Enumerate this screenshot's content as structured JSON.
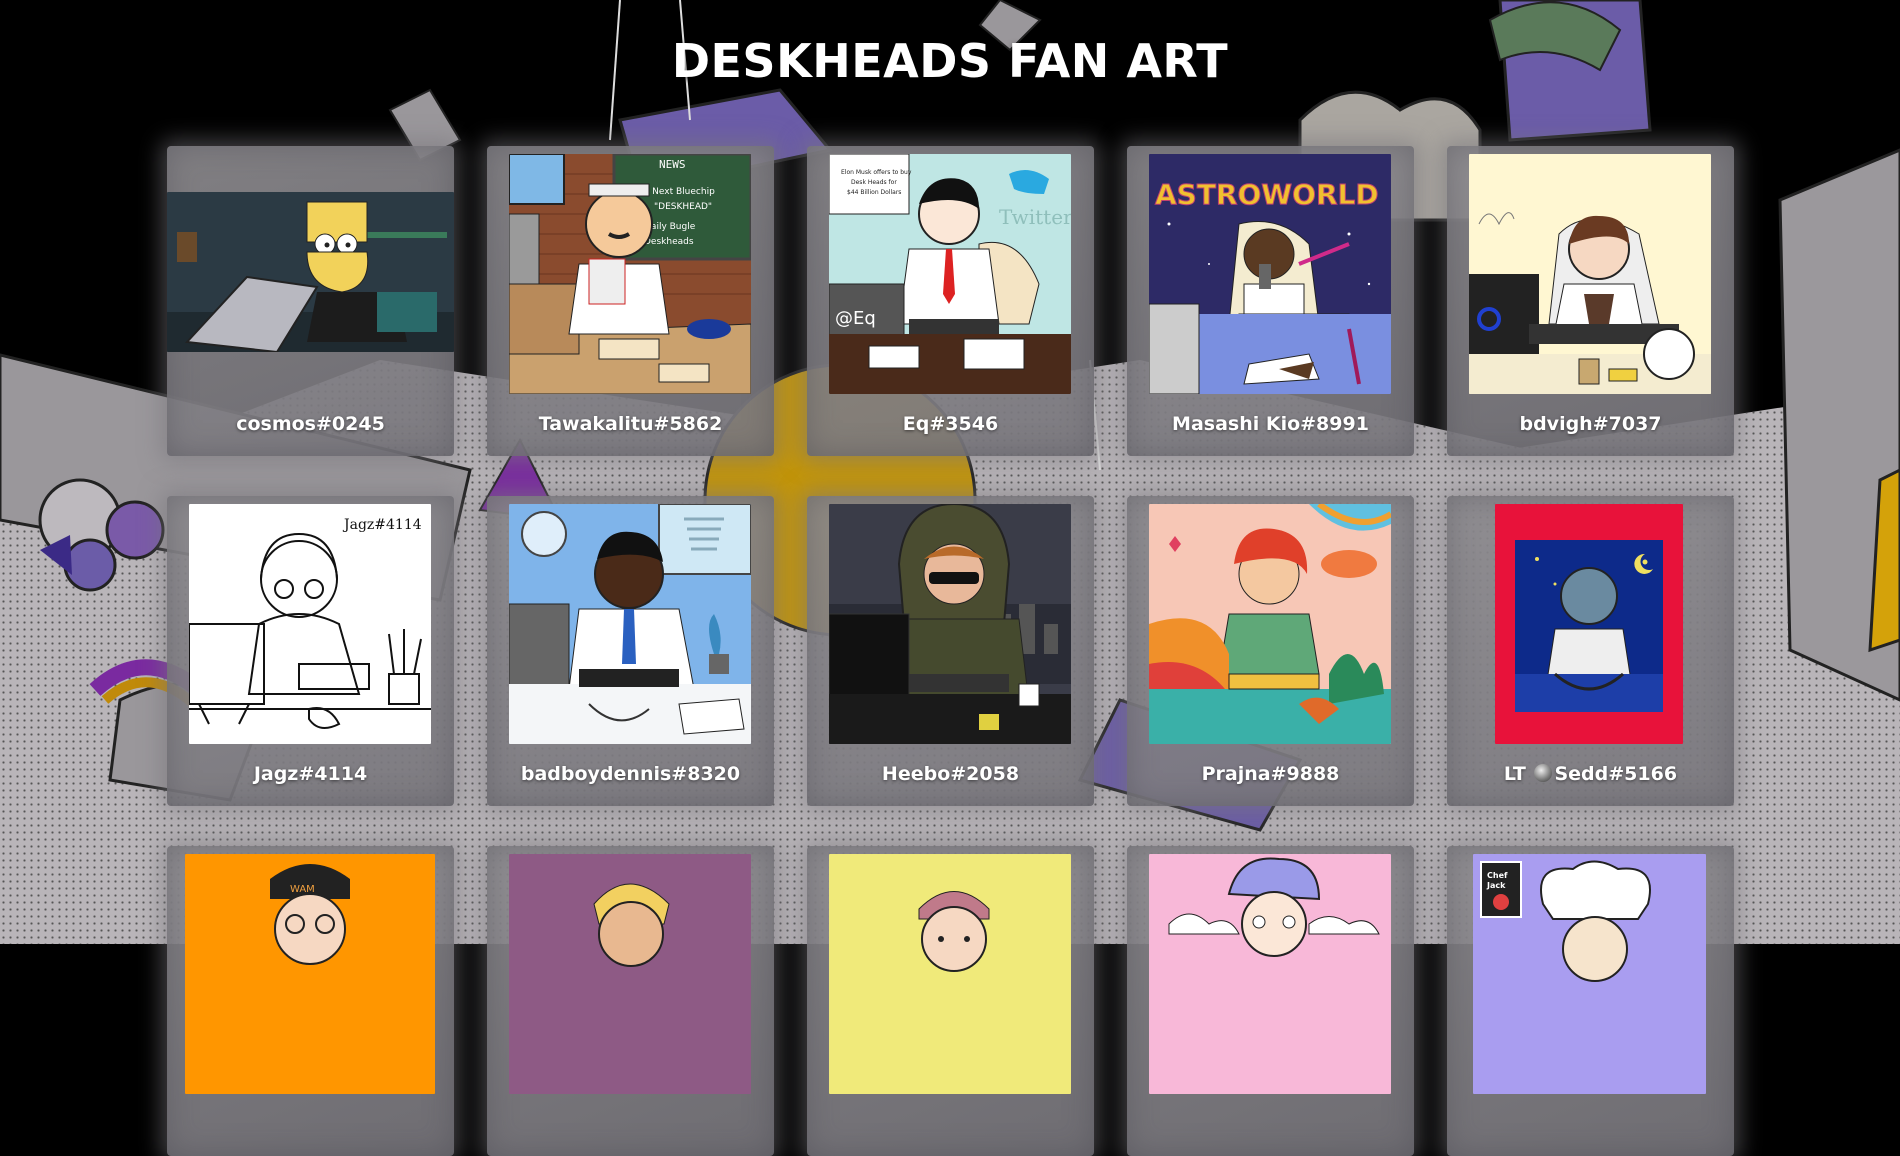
{
  "page": {
    "title": "DESKHEADS FAN ART"
  },
  "gallery": {
    "items": [
      {
        "author": "cosmos#0245",
        "art": "bart-laptop",
        "bg": "#2b3a44"
      },
      {
        "author": "Tawakalitu#5862",
        "art": "news-desk",
        "bg": "#8a4b2e"
      },
      {
        "author": "Eq#3546",
        "art": "twitter-office",
        "bg": "#bfe6e4",
        "inner_text": "@Eq"
      },
      {
        "author": "Masashi Kio#8991",
        "art": "astroworld",
        "bg": "#2d2a66",
        "inner_text": "ASTROWORLD"
      },
      {
        "author": "bdvigh#7037",
        "art": "cream-desk",
        "bg": "#fff7d2"
      },
      {
        "author": "Jagz#4114",
        "art": "line-sketch",
        "bg": "#ffffff",
        "inner_text": "Jagz#4114"
      },
      {
        "author": "badboydennis#8320",
        "art": "doctor-desk",
        "bg": "#7fb4ea"
      },
      {
        "author": "Heebo#2058",
        "art": "hoodie-night",
        "bg": "#3a3c48"
      },
      {
        "author": "Prajna#9888",
        "art": "colorful-desk",
        "bg": "#f7c7b6"
      },
      {
        "author_prefix": "LT",
        "author_suffix": "Sedd#5166",
        "art": "red-frame",
        "bg": "#e8123a"
      },
      {
        "author": "",
        "art": "orange-beanie",
        "bg": "#ff9600"
      },
      {
        "author": "",
        "art": "mauve-blond",
        "bg": "#8e5a85"
      },
      {
        "author": "",
        "art": "yellow-cap",
        "bg": "#f0ea7a"
      },
      {
        "author": "",
        "art": "pink-cloud",
        "bg": "#f8b8d8"
      },
      {
        "author": "",
        "art": "chef-jack",
        "bg": "#a99df0",
        "inner_text": "Chef Jack"
      }
    ]
  },
  "colors": {
    "background": "#000000",
    "card": "#8c8a8e",
    "accent_purple": "#6b5ca8",
    "title": "#ffffff"
  }
}
